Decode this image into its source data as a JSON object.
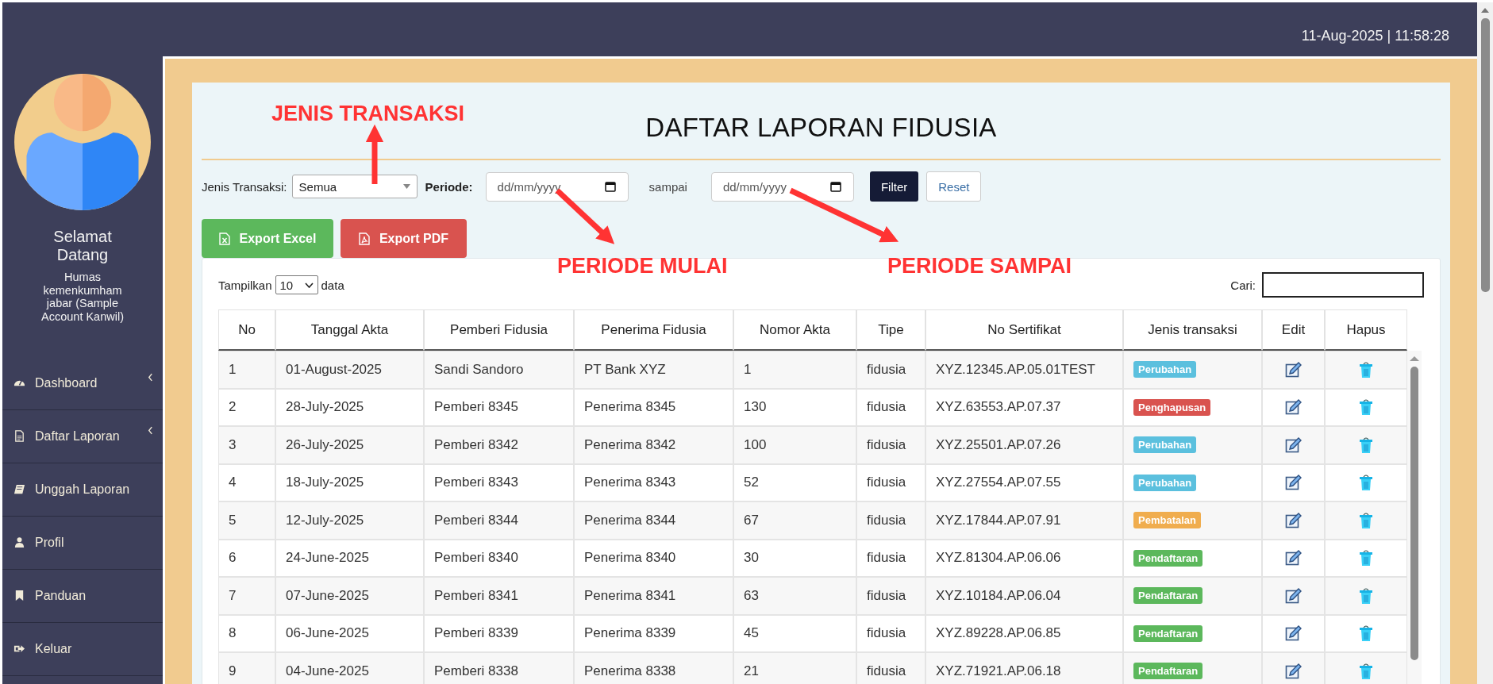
{
  "top_bar": {
    "datetime": "11-Aug-2025 | 11:58:28"
  },
  "sidebar": {
    "greeting": "Selamat Datang",
    "user": "Humas kemenkumham jabar (Sample Account Kanwil)",
    "items": [
      {
        "label": "Dashboard",
        "has_submenu": true
      },
      {
        "label": "Daftar Laporan",
        "has_submenu": true
      },
      {
        "label": "Unggah Laporan",
        "has_submenu": false
      },
      {
        "label": "Profil",
        "has_submenu": false
      },
      {
        "label": "Panduan",
        "has_submenu": false
      },
      {
        "label": "Keluar",
        "has_submenu": false
      }
    ]
  },
  "page": {
    "title": "DAFTAR LAPORAN FIDUSIA",
    "filters": {
      "type_label": "Jenis Transaksi:",
      "type_value": "Semua",
      "period_label": "Periode:",
      "start_placeholder": "dd/mm/yyyy",
      "until_label": "sampai",
      "end_placeholder": "dd/mm/yyyy",
      "filter_button": "Filter",
      "reset_button": "Reset"
    },
    "exports": [
      {
        "label": "Export Excel",
        "kind": "excel"
      },
      {
        "label": "Export PDF",
        "kind": "pdf"
      }
    ],
    "annotations": [
      {
        "text": "JENIS TRANSAKSI"
      },
      {
        "text": "PERIODE MULAI"
      },
      {
        "text": "PERIODE SAMPAI"
      }
    ]
  },
  "table": {
    "show_label": "Tampilkan",
    "page_size": "10",
    "show_suffix": "data",
    "search_label": "Cari:",
    "columns": [
      "No",
      "Tanggal Akta",
      "Pemberi Fidusia",
      "Penerima Fidusia",
      "Nomor Akta",
      "Tipe",
      "No Sertifikat",
      "Jenis transaksi",
      "Edit",
      "Hapus"
    ],
    "rows": [
      {
        "cells": [
          "1",
          "01-August-2025",
          "Sandi Sandoro",
          "PT Bank XYZ",
          "1",
          "fidusia",
          "XYZ.12345.AP.05.01TEST"
        ],
        "type": "Perubahan",
        "color": "#5bc0de"
      },
      {
        "cells": [
          "2",
          "28-July-2025",
          "Pemberi 8345",
          "Penerima 8345",
          "130",
          "fidusia",
          "XYZ.63553.AP.07.37"
        ],
        "type": "Penghapusan",
        "color": "#d9534f"
      },
      {
        "cells": [
          "3",
          "26-July-2025",
          "Pemberi 8342",
          "Penerima 8342",
          "100",
          "fidusia",
          "XYZ.25501.AP.07.26"
        ],
        "type": "Perubahan",
        "color": "#5bc0de"
      },
      {
        "cells": [
          "4",
          "18-July-2025",
          "Pemberi 8343",
          "Penerima 8343",
          "52",
          "fidusia",
          "XYZ.27554.AP.07.55"
        ],
        "type": "Perubahan",
        "color": "#5bc0de"
      },
      {
        "cells": [
          "5",
          "12-July-2025",
          "Pemberi 8344",
          "Penerima 8344",
          "67",
          "fidusia",
          "XYZ.17844.AP.07.91"
        ],
        "type": "Pembatalan",
        "color": "#f0ad4e"
      },
      {
        "cells": [
          "6",
          "24-June-2025",
          "Pemberi 8340",
          "Penerima 8340",
          "30",
          "fidusia",
          "XYZ.81304.AP.06.06"
        ],
        "type": "Pendaftaran",
        "color": "#5cb85c"
      },
      {
        "cells": [
          "7",
          "07-June-2025",
          "Pemberi 8341",
          "Penerima 8341",
          "63",
          "fidusia",
          "XYZ.10184.AP.06.04"
        ],
        "type": "Pendaftaran",
        "color": "#5cb85c"
      },
      {
        "cells": [
          "8",
          "06-June-2025",
          "Pemberi 8339",
          "Penerima 8339",
          "45",
          "fidusia",
          "XYZ.89228.AP.06.85"
        ],
        "type": "Pendaftaran",
        "color": "#5cb85c"
      },
      {
        "cells": [
          "9",
          "04-June-2025",
          "Pemberi 8338",
          "Penerima 8338",
          "21",
          "fidusia",
          "XYZ.71921.AP.06.18"
        ],
        "type": "Pendaftaran",
        "color": "#5cb85c"
      }
    ]
  }
}
